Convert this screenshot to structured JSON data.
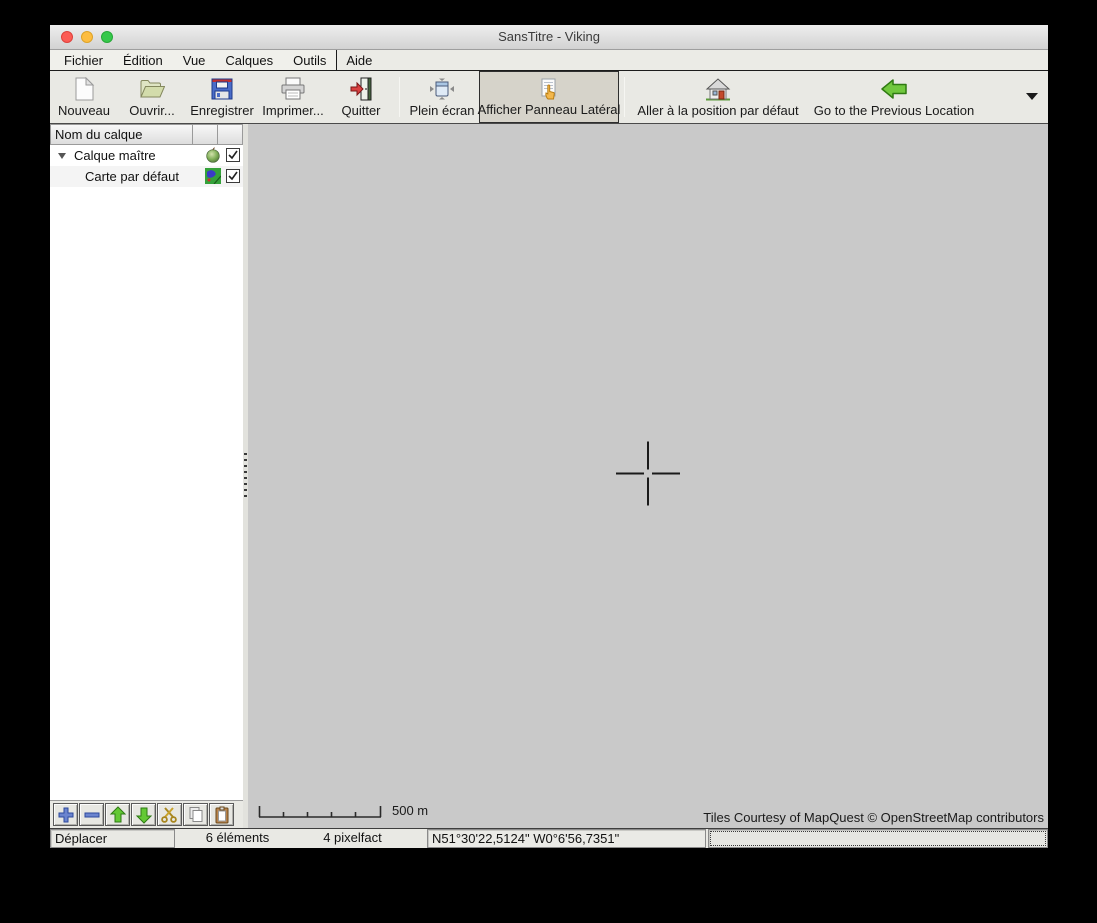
{
  "window": {
    "title": "SansTitre - Viking",
    "traffic_lights": [
      "close",
      "minimize",
      "zoom"
    ]
  },
  "menu": {
    "items": [
      {
        "label": "Fichier"
      },
      {
        "label": "Édition"
      },
      {
        "label": "Vue"
      },
      {
        "label": "Calques"
      },
      {
        "label": "Outils"
      },
      {
        "label": "Aide"
      }
    ]
  },
  "toolbar": {
    "buttons": [
      {
        "label": "Nouveau",
        "icon": "new-document-icon"
      },
      {
        "label": "Ouvrir...",
        "icon": "open-folder-icon"
      },
      {
        "label": "Enregistrer",
        "icon": "save-floppy-icon"
      },
      {
        "label": "Imprimer...",
        "icon": "printer-icon"
      },
      {
        "label": "Quitter",
        "icon": "quit-door-icon"
      },
      {
        "label": "Plein écran",
        "icon": "fullscreen-icon"
      },
      {
        "label": "Afficher Panneau Latéral",
        "icon": "side-panel-icon",
        "pressed": true
      },
      {
        "label": "Aller à la position par défaut",
        "icon": "home-icon"
      },
      {
        "label": "Go to the Previous Location",
        "icon": "back-arrow-icon"
      }
    ],
    "overflow_icon": "chevron-down-icon"
  },
  "sidebar": {
    "header": "Nom du calque",
    "layers": [
      {
        "name": "Calque maître",
        "icon": "aggregate-layer-icon",
        "checked": true,
        "expanded": true
      },
      {
        "name": "Carte par défaut",
        "icon": "map-layer-icon",
        "checked": true
      }
    ],
    "buttons": [
      {
        "icon": "add-layer-icon"
      },
      {
        "icon": "remove-layer-icon"
      },
      {
        "icon": "move-up-icon"
      },
      {
        "icon": "move-down-icon"
      },
      {
        "icon": "cut-icon"
      },
      {
        "icon": "copy-icon"
      },
      {
        "icon": "paste-icon"
      }
    ]
  },
  "map": {
    "scale_label": "500 m",
    "attribution": "Tiles Courtesy of MapQuest © OpenStreetMap contributors",
    "background_color": "#c9c9c9"
  },
  "statusbar": {
    "tool": "Déplacer",
    "items_count": "6 éléments",
    "zoom_factor": "4 pixelfact",
    "coordinates": "N51°30'22,5124\" W0°6'56,7351\""
  },
  "colors": {
    "toolbar_pressed_bg": "#d6d3ca",
    "back_arrow_green": "#71c83e",
    "save_blue": "#4a6cc8",
    "layer_add_blue": "#6b84cf",
    "layer_arrow_green": "#63c934"
  }
}
